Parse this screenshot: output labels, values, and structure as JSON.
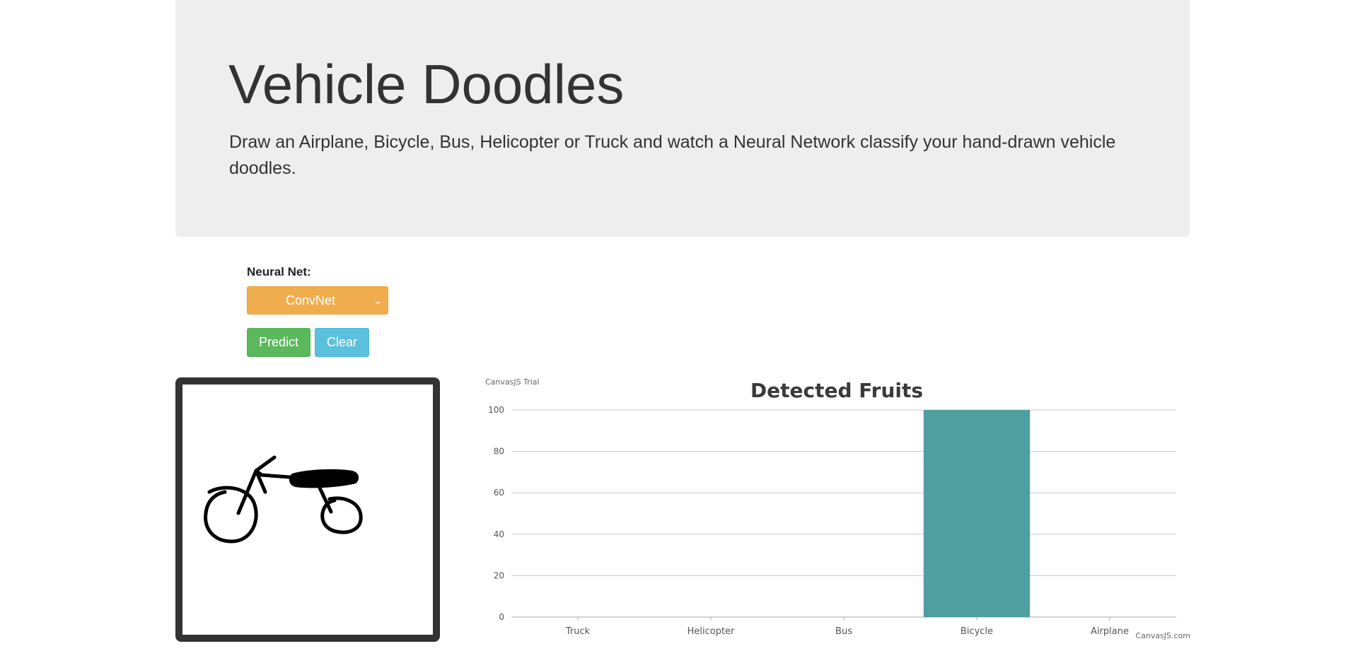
{
  "header": {
    "title": "Vehicle Doodles",
    "description": "Draw an Airplane, Bicycle, Bus, Helicopter or Truck and watch a Neural Network classify your hand-drawn vehicle doodles."
  },
  "controls": {
    "net_label": "Neural Net:",
    "net_selected": "ConvNet",
    "predict_label": "Predict",
    "clear_label": "Clear"
  },
  "colors": {
    "select": "#f0ad4e",
    "predict": "#5cb85c",
    "clear": "#5bc0de",
    "bar": "#4f9ea0"
  },
  "chart_meta": {
    "trial_text": "CanvasJS Trial",
    "credit_text": "CanvasJS.com"
  },
  "chart_data": {
    "type": "bar",
    "title": "Detected Fruits",
    "categories": [
      "Truck",
      "Helicopter",
      "Bus",
      "Bicycle",
      "Airplane"
    ],
    "values": [
      0,
      0,
      0,
      100,
      0
    ],
    "ylim": [
      0,
      100
    ],
    "yticks": [
      0,
      20,
      40,
      60,
      80,
      100
    ],
    "grid": true,
    "bar_color": "#4f9ea0"
  }
}
